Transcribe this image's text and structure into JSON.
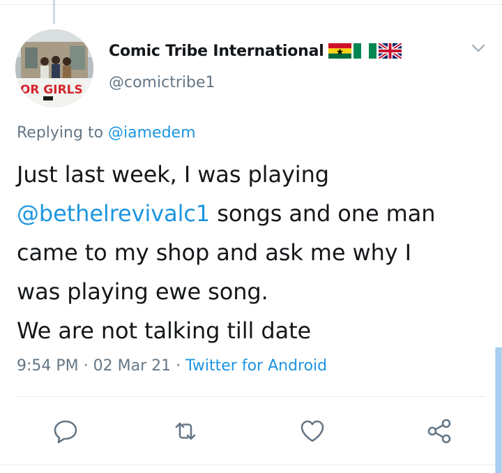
{
  "tweet": {
    "author": {
      "display_name": "Comic Tribe International",
      "handle": "@comictribe1",
      "flags": [
        "ghana-flag",
        "nigeria-flag",
        "uk-flag"
      ],
      "avatar_text": "FOR GIRLS"
    },
    "replying_to": {
      "prefix": "Replying to",
      "mention": "@iamedem"
    },
    "body": {
      "line1": "Just last week, I was playing",
      "mention": "@bethelrevivalc1",
      "line2_rest": " songs and one man",
      "line3": "came to my shop and ask me why I",
      "line4": "was playing ewe song.",
      "line5": "We are not talking till date"
    },
    "meta": {
      "time": "9:54 PM",
      "separator": " · ",
      "date": "02 Mar 21",
      "source": "Twitter for Android"
    },
    "actions": [
      "reply-icon",
      "retweet-icon",
      "like-icon",
      "share-icon"
    ],
    "menu_icon": "chevron-down-icon"
  },
  "colors": {
    "text": "#14171a",
    "secondary": "#657786",
    "link": "#1b95e0",
    "icon": "#657786",
    "border": "#e6ecf0"
  }
}
